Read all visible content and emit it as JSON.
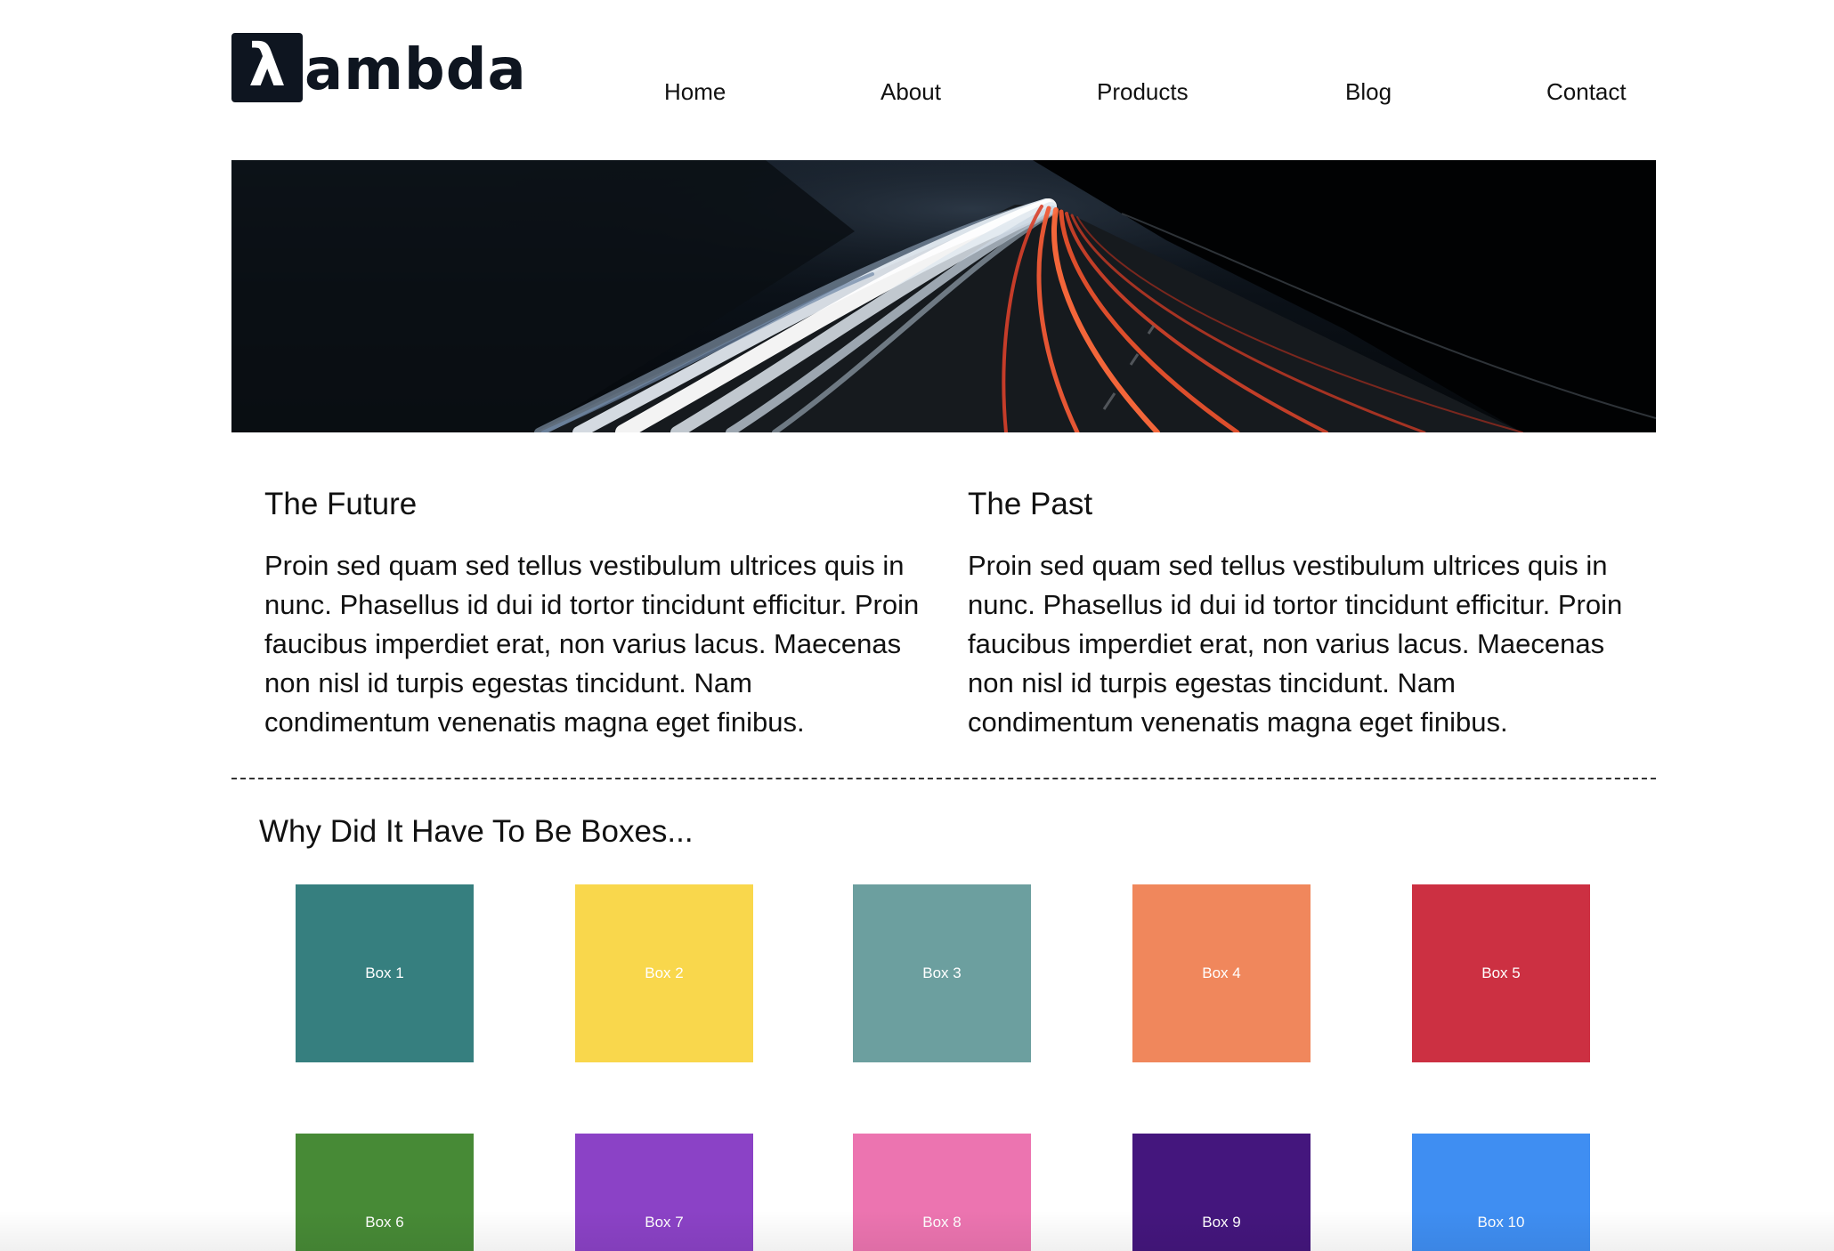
{
  "brand": {
    "logo_glyph": "λ",
    "logo_text": "ambda",
    "logo_color": "#0e1520"
  },
  "nav": {
    "items": [
      {
        "label": "Home"
      },
      {
        "label": "About"
      },
      {
        "label": "Products"
      },
      {
        "label": "Blog"
      },
      {
        "label": "Contact"
      }
    ]
  },
  "hero": {
    "image": "long-exposure-highway-light-trails"
  },
  "columns": [
    {
      "title": "The Future",
      "body": "Proin sed quam sed tellus vestibulum ultrices quis in nunc. Phasellus id dui id tortor tincidunt efficitur. Proin faucibus imperdiet erat, non varius lacus. Maecenas non nisl id turpis egestas tincidunt. Nam condimentum venenatis magna eget finibus."
    },
    {
      "title": "The Past",
      "body": "Proin sed quam sed tellus vestibulum ultrices quis in nunc. Phasellus id dui id tortor tincidunt efficitur. Proin faucibus imperdiet erat, non varius lacus. Maecenas non nisl id turpis egestas tincidunt. Nam condimentum venenatis magna eget finibus."
    }
  ],
  "boxes_section": {
    "heading": "Why Did It Have To Be Boxes...",
    "boxes": [
      {
        "label": "Box 1",
        "color": "#367f7f"
      },
      {
        "label": "Box 2",
        "color": "#f9d74c"
      },
      {
        "label": "Box 3",
        "color": "#6c9f9f"
      },
      {
        "label": "Box 4",
        "color": "#f0875c"
      },
      {
        "label": "Box 5",
        "color": "#cc3042"
      },
      {
        "label": "Box 6",
        "color": "#478a36"
      },
      {
        "label": "Box 7",
        "color": "#8b42c6"
      },
      {
        "label": "Box 8",
        "color": "#ec74b0"
      },
      {
        "label": "Box 9",
        "color": "#44167d"
      },
      {
        "label": "Box 10",
        "color": "#3f8ef2"
      }
    ]
  }
}
